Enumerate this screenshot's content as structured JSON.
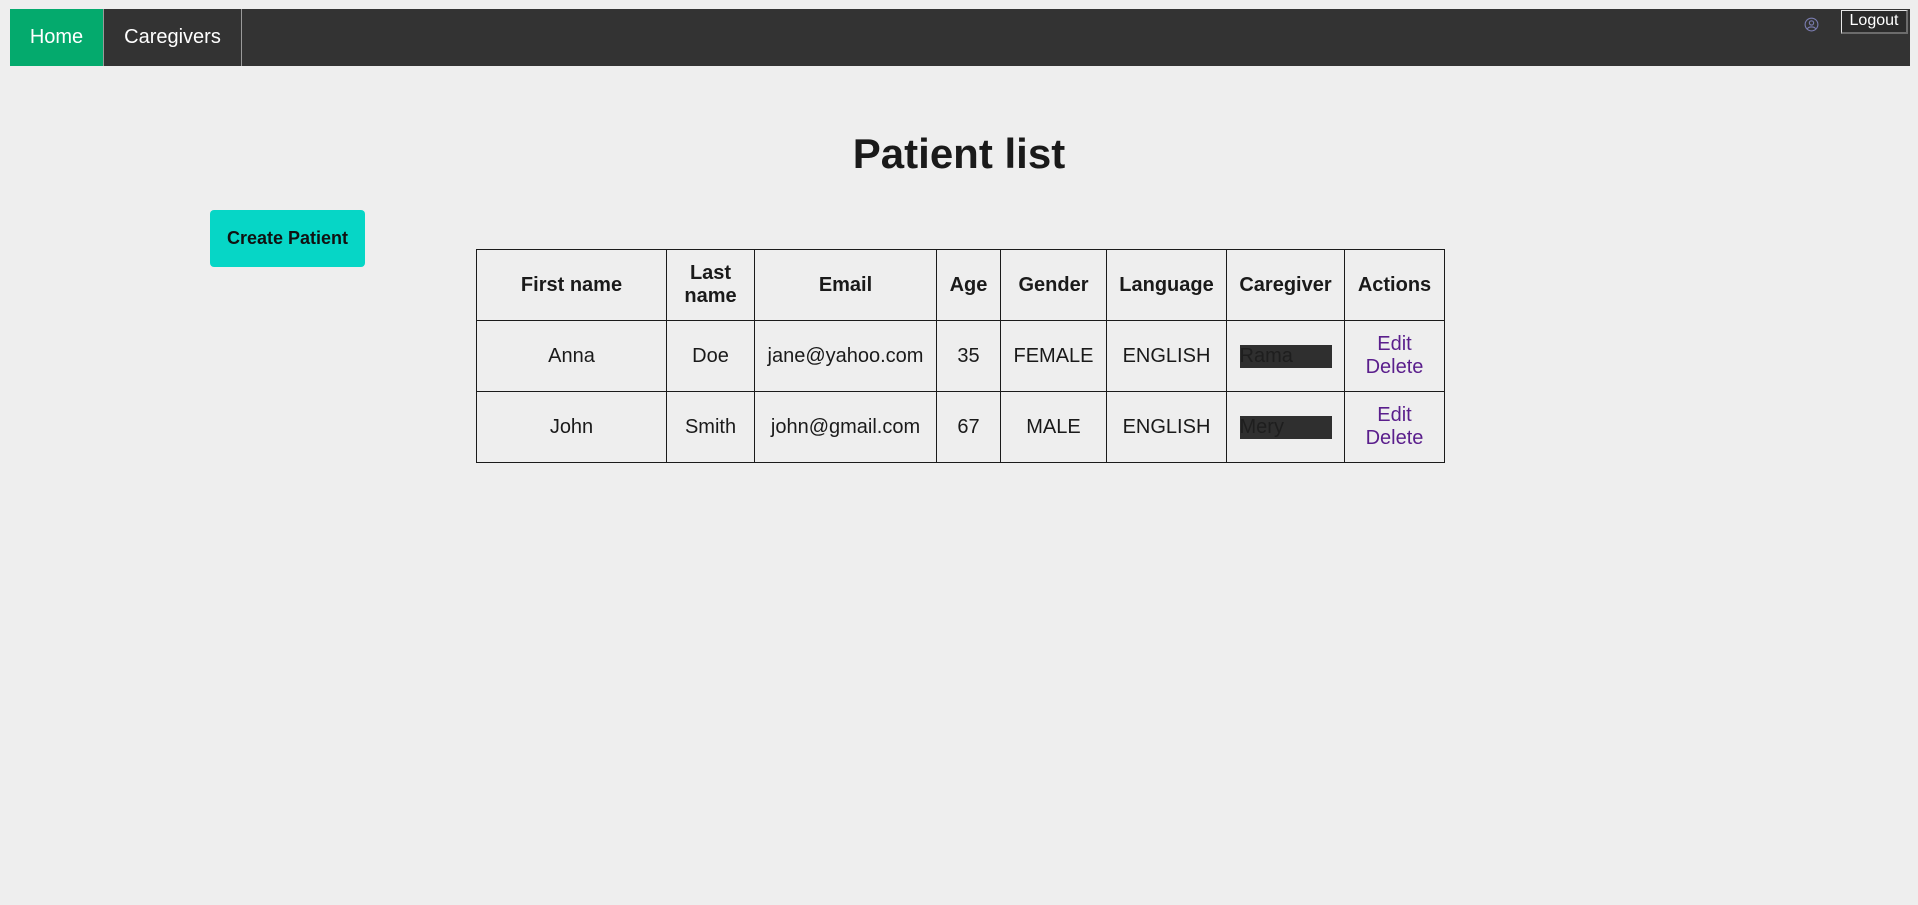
{
  "nav": {
    "items": [
      {
        "label": "Home",
        "active": true
      },
      {
        "label": "Caregivers",
        "active": false
      }
    ],
    "user_icon": "user-circle-icon",
    "logout_label": "Logout"
  },
  "page": {
    "title": "Patient list",
    "create_label": "Create Patient"
  },
  "table": {
    "headers": [
      "First name",
      "Last name",
      "Email",
      "Age",
      "Gender",
      "Language",
      "Caregiver",
      "Actions"
    ],
    "rows": [
      {
        "first_name": "Anna",
        "last_name": "Doe",
        "email": "jane@yahoo.com",
        "age": "35",
        "gender": "FEMALE",
        "language": "ENGLISH",
        "caregiver": "Rama",
        "edit": "Edit",
        "delete": "Delete"
      },
      {
        "first_name": "John",
        "last_name": "Smith",
        "email": "john@gmail.com",
        "age": "67",
        "gender": "MALE",
        "language": "ENGLISH",
        "caregiver": "Mery",
        "edit": "Edit",
        "delete": "Delete"
      }
    ]
  },
  "colors": {
    "navbar": "#333333",
    "active_nav": "#04aa6d",
    "create_button": "#06d6c6",
    "link": "#5a1e8c",
    "background": "#eeeeee"
  }
}
